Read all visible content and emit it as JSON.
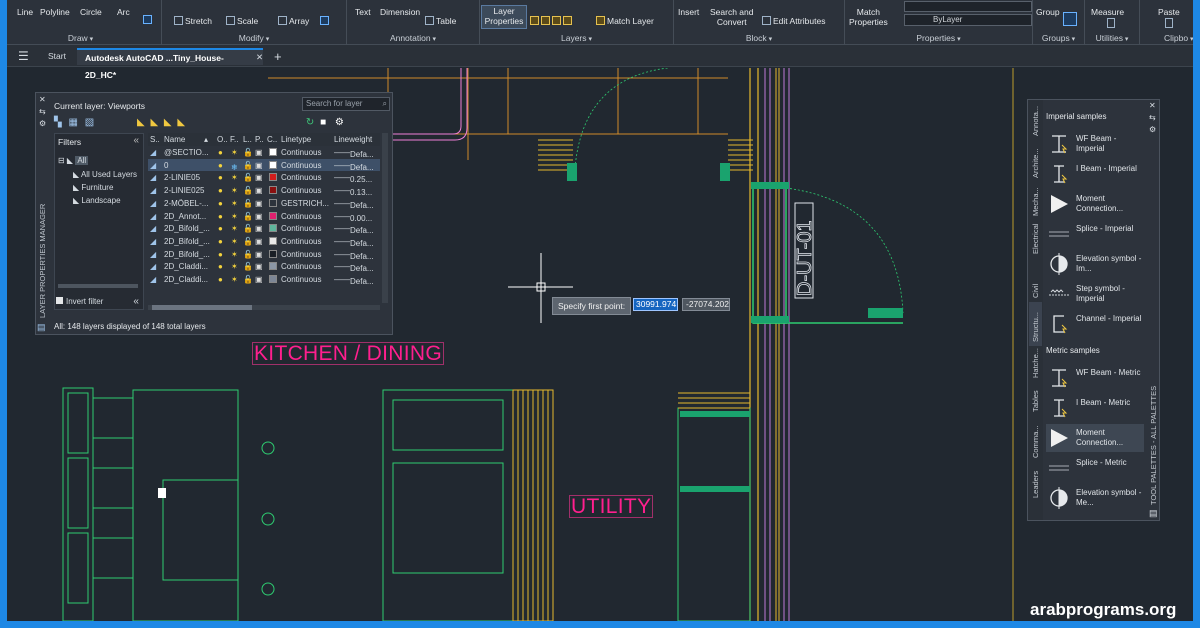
{
  "ribbon": {
    "draw": {
      "line": "Line",
      "polyline": "Polyline",
      "circle": "Circle",
      "arc": "Arc",
      "title": "Draw"
    },
    "modify": {
      "stretch": "Stretch",
      "scale": "Scale",
      "array": "Array",
      "title": "Modify"
    },
    "annotation": {
      "text": "Text",
      "dimension": "Dimension",
      "table": "Table",
      "title": "Annotation"
    },
    "layers": {
      "layer_properties_1": "Layer",
      "layer_properties_2": "Properties",
      "match_layer": "Match Layer",
      "title": "Layers"
    },
    "block": {
      "insert": "Insert",
      "search_1": "Search and",
      "search_2": "Convert",
      "edit_attributes": "Edit Attributes",
      "title": "Block"
    },
    "properties": {
      "match_1": "Match",
      "match_2": "Properties",
      "bylayer": "ByLayer",
      "title": "Properties"
    },
    "groups": {
      "group": "Group",
      "title": "Groups"
    },
    "utilities": {
      "measure": "Measure",
      "title": "Utilities"
    },
    "clipboard": {
      "paste": "Paste",
      "title": "Clipbo"
    }
  },
  "tabs": {
    "start": "Start",
    "active": "Autodesk AutoCAD ...Tiny_House-2D_HC*",
    "add": "+"
  },
  "layer_manager": {
    "vertical_title": "LAYER PROPERTIES MANAGER",
    "current_layer": "Current layer: Viewports",
    "search_placeholder": "Search for layer",
    "filters_header": "Filters",
    "filter_all": "All",
    "filter_used": "All Used Layers",
    "filter_furniture": "Furniture",
    "filter_landscape": "Landscape",
    "invert_filter": "Invert filter",
    "status": "All: 148 layers displayed of 148 total layers",
    "columns": {
      "status": "S..",
      "name": "Name",
      "on": "O..",
      "freeze": "F..",
      "lock": "L..",
      "plot": "P..",
      "color": "C..",
      "linetype": "Linetype",
      "lineweight": "Lineweight"
    },
    "rows": [
      {
        "name": "@SECTIO...",
        "color": "#ffffff",
        "linetype": "Continuous",
        "lineweight": "Defa..."
      },
      {
        "name": "0",
        "color": "#ffffff",
        "linetype": "Continuous",
        "lineweight": "Defa..."
      },
      {
        "name": "2-LINIE05",
        "color": "#d01c1c",
        "linetype": "Continuous",
        "lineweight": "0.25..."
      },
      {
        "name": "2-LINIE025",
        "color": "#8a1010",
        "linetype": "Continuous",
        "lineweight": "0.13..."
      },
      {
        "name": "2-MÖBEL-...",
        "color": "#2d333c",
        "linetype": "GESTRICH...",
        "lineweight": "Defa..."
      },
      {
        "name": "2D_Annot...",
        "color": "#e0206e",
        "linetype": "Continuous",
        "lineweight": "0.00..."
      },
      {
        "name": "2D_Bifold_...",
        "color": "#5fb59c",
        "linetype": "Continuous",
        "lineweight": "Defa..."
      },
      {
        "name": "2D_Bifold_...",
        "color": "#e8e8e8",
        "linetype": "Continuous",
        "lineweight": "Defa..."
      },
      {
        "name": "2D_Bifold_...",
        "color": "#1a1f26",
        "linetype": "Continuous",
        "lineweight": "Defa..."
      },
      {
        "name": "2D_Claddi...",
        "color": "#8c97a6",
        "linetype": "Continuous",
        "lineweight": "Defa..."
      },
      {
        "name": "2D_Claddi...",
        "color": "#7c8696",
        "linetype": "Continuous",
        "lineweight": "Defa..."
      }
    ]
  },
  "tool_palette": {
    "side_title": "TOOL PALETTES - ALL PALETTES",
    "tabs": [
      "Annota...",
      "Archite...",
      "Mecha...",
      "Electrical",
      "Civil",
      "Structu...",
      "Hatche...",
      "Tables",
      "Comma...",
      "Leaders"
    ],
    "imperial_header": "Imperial samples",
    "metric_header": "Metric samples",
    "imperial_items": [
      {
        "label": "WF Beam - Imperial",
        "icon": "wf-beam-icon"
      },
      {
        "label": "I Beam - Imperial",
        "icon": "i-beam-icon"
      },
      {
        "label": "Moment Connection...",
        "icon": "moment-icon"
      },
      {
        "label": "Splice - Imperial",
        "icon": "splice-icon"
      },
      {
        "label": "Elevation symbol - Im...",
        "icon": "elevation-icon"
      },
      {
        "label": "Step symbol - Imperial",
        "icon": "step-icon"
      },
      {
        "label": "Channel - Imperial",
        "icon": "channel-icon"
      }
    ],
    "metric_items": [
      {
        "label": "WF Beam - Metric",
        "icon": "wf-beam-icon"
      },
      {
        "label": "I Beam - Metric",
        "icon": "i-beam-icon"
      },
      {
        "label": "Moment Connection...",
        "icon": "moment-icon"
      },
      {
        "label": "Splice - Metric",
        "icon": "splice-icon"
      },
      {
        "label": "Elevation symbol - Me...",
        "icon": "elevation-icon"
      }
    ]
  },
  "command": {
    "prompt": "Specify first point:",
    "x": "30991.974",
    "y": "-27074.202"
  },
  "labels": {
    "kitchen": "KITCHEN / DINING",
    "utility": "UTILITY",
    "section": "D-UT-01"
  },
  "watermark": "arabprograms.org",
  "colors": {
    "accent": "#1e88e5",
    "room_label": "#ff1f8e",
    "canvas": "#212830",
    "linework_green": "#2ecc71",
    "linework_yellow": "#e5b92e"
  }
}
